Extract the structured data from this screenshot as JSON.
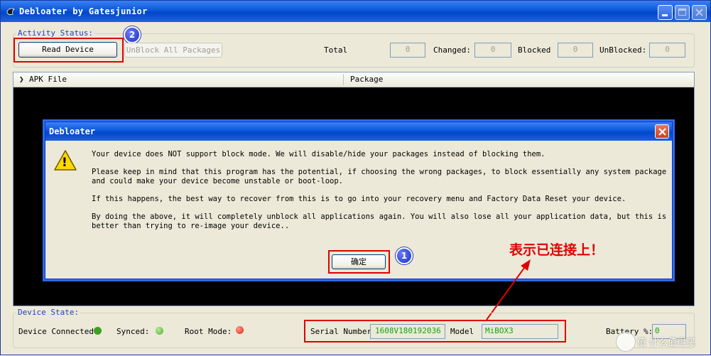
{
  "window": {
    "title": "Debloater by Gatesjunior"
  },
  "activity": {
    "label": "Activity Status:",
    "read_device": "Read Device",
    "unblock_all": "UnBlock All Packages",
    "total_label": "Total",
    "total_value": "0",
    "changed_label": "Changed:",
    "changed_value": "0",
    "blocked_label": "Blocked",
    "blocked_value": "0",
    "unblocked_label": "UnBlocked:",
    "unblocked_value": "0"
  },
  "list": {
    "col_apk": "APK File",
    "col_package": "Package",
    "expander": "❯"
  },
  "dialog": {
    "title": "Debloater",
    "messages": [
      "Your device does NOT support block mode.  We will disable/hide your packages instead of blocking them.",
      "Please keep in mind that this program has the potential, if choosing the wrong packages, to block essentially any system package\nand could make your device become unstable or boot-loop.",
      "If this happens, the best way to recover from this is to go into your recovery menu and Factory Data Reset your device.",
      "By doing the above, it will completely unblock all applications again.  You will also lose all your application data, but this is\nbetter than trying to re-image your device.."
    ],
    "ok": "确定",
    "warning_glyph": "!",
    "close_glyph": "✕"
  },
  "device_state": {
    "label": "Device State:",
    "connected_label": "Device Connected:",
    "synced_label": "Synced:",
    "root_label": "Root Mode:",
    "serial_label": "Serial Number:",
    "serial_value": "1608V180192036",
    "model_label": "Model",
    "model_value": "MiBOX3",
    "battery_label": "Battery %:",
    "battery_value": "0"
  },
  "annotations": {
    "badge1": "1",
    "badge2": "2",
    "note": "表示已连接上！"
  },
  "watermark": "值 什么值得买",
  "colors": {
    "annotation": "#e00000",
    "synced": "#4caf2a",
    "root": "#e02010",
    "connected": "#3ea020"
  }
}
